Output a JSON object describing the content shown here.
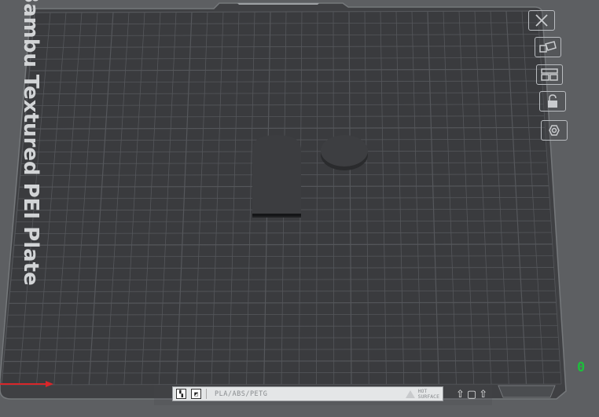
{
  "plate": {
    "label": "Bambu Textured PEI Plate",
    "filament_types": "PLA/ABS/PETG",
    "hot_text": "HOT\nSURFACE"
  },
  "side_toolbar": [
    {
      "name": "close-plate-button",
      "icon": "x-icon"
    },
    {
      "name": "auto-orient-button",
      "icon": "orient-icon"
    },
    {
      "name": "arrange-button",
      "icon": "arrange-icon"
    },
    {
      "name": "lock-plate-button",
      "icon": "lock-icon"
    },
    {
      "name": "plate-settings-button",
      "icon": "settings-hex-icon"
    }
  ],
  "axis": {
    "origin_label": "0"
  },
  "colors": {
    "background": "#5d5f62",
    "plate": "#3a3b3e",
    "grid": "#55575b",
    "x_axis": "#d9262a",
    "y_axis": "#1dbf3c"
  }
}
